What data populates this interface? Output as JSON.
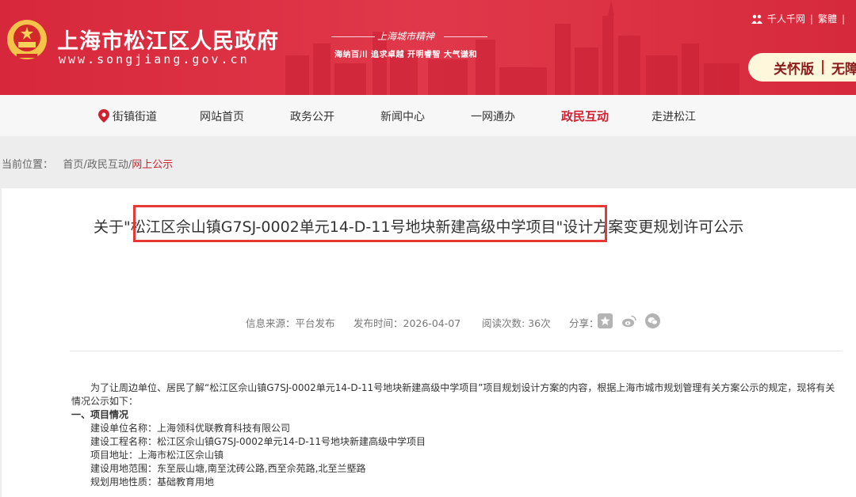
{
  "header": {
    "site_name": "上海市松江区人民政府",
    "site_url": "www.songjiang.gov.cn",
    "slogan_title": "上海城市精神",
    "slogan_sub": "海纳百川  追求卓越  开明睿智  大气谦和",
    "top_links": [
      "千人千网",
      "繁體"
    ],
    "care_label": "关怀版",
    "care_label2": "无障",
    "brand_color": "#d7283b"
  },
  "nav": {
    "items": [
      "街镇街道",
      "网站首页",
      "政务公开",
      "新闻中心",
      "一网通办",
      "政民互动",
      "走进松江"
    ],
    "active": "政民互动"
  },
  "breadcrumb": {
    "label": "当前位置：",
    "home": "首页",
    "section": "政民互动",
    "current": "网上公示"
  },
  "article": {
    "title_prefix": "关于\"",
    "title_highlight": "松江区佘山镇G7SJ-0002单元14-D-11号地块新建高级中学项目",
    "title_suffix": "\"设计方案变更规划许可公示",
    "source": "信息来源：平台发布",
    "date": "发布时间：2026-04-07",
    "views": "阅读次数: 36次",
    "share_label": "分享：",
    "intro": "为了让周边单位、居民了解“松江区佘山镇G7SJ-0002单元14-D-11号地块新建高级中学项目”项目规划设计方案的内容，根据上海市城市规划管理有关方案公示的规定，现将有关情况公示如下：",
    "section1": "一、项目情况",
    "lines": [
      "建设单位名称：上海领科优联教育科技有限公司",
      "建设工程名称：松江区佘山镇G7SJ-0002单元14-D-11号地块新建高级中学项目",
      "项目地址：上海市松江区佘山镇",
      "建设用地范围：东至辰山塘,南至沈砖公路,西至佘苑路,北至兰塈路",
      "规划用地性质：基础教育用地"
    ]
  }
}
